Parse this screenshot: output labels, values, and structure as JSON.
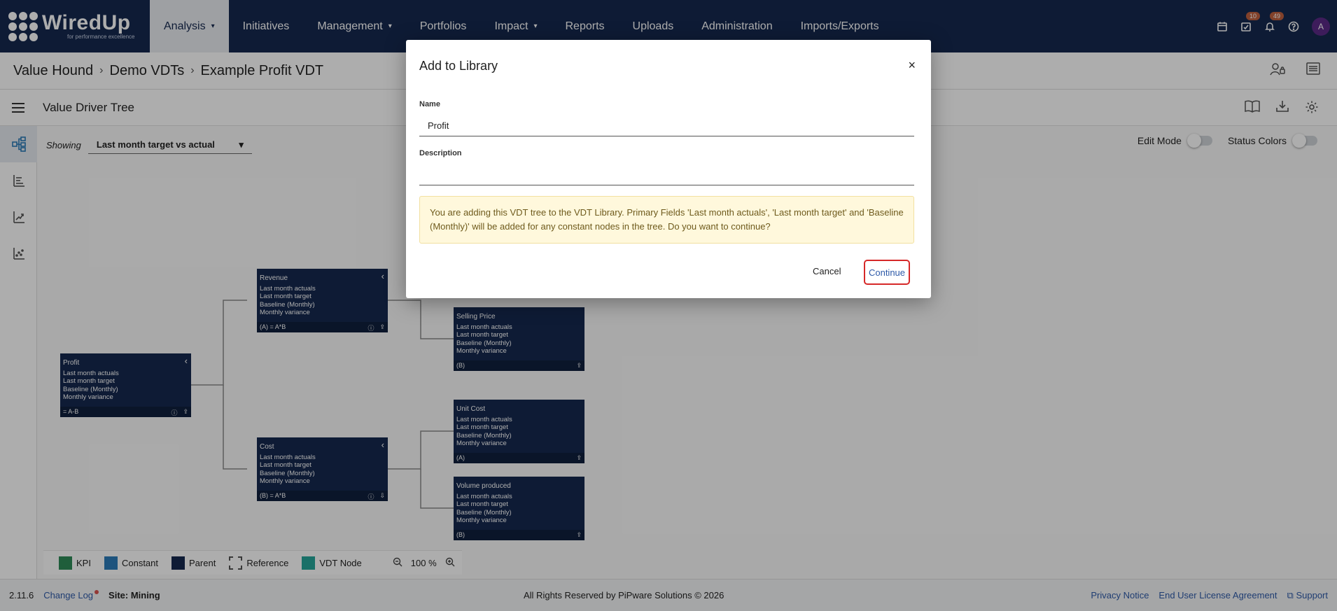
{
  "brand": {
    "word": "WiredUp",
    "tagline": "for performance excellence"
  },
  "nav": {
    "items": [
      {
        "label": "Analysis",
        "caret": "▾"
      },
      {
        "label": "Initiatives",
        "caret": ""
      },
      {
        "label": "Management",
        "caret": "▾"
      },
      {
        "label": "Portfolios",
        "caret": ""
      },
      {
        "label": "Impact",
        "caret": "▾"
      },
      {
        "label": "Reports",
        "caret": ""
      },
      {
        "label": "Uploads",
        "caret": ""
      },
      {
        "label": "Administration",
        "caret": ""
      },
      {
        "label": "Imports/Exports",
        "caret": ""
      }
    ],
    "tasks_badge": "10",
    "notifications_badge": "49",
    "avatar": "A"
  },
  "breadcrumb": [
    "Value Hound",
    "Demo VDTs",
    "Example Profit VDT"
  ],
  "toolbar": {
    "title": "Value Driver Tree"
  },
  "showing": {
    "label": "Showing",
    "value": "Last month target vs actual"
  },
  "toggles": {
    "edit_mode": "Edit Mode",
    "status_colors": "Status Colors"
  },
  "nodes": [
    {
      "title": "Profit",
      "fields": [
        "Last month actuals",
        "Last month target",
        "Baseline (Monthly)",
        "Monthly variance"
      ],
      "formula": "= A-B"
    },
    {
      "title": "Revenue",
      "fields": [
        "Last month actuals",
        "Last month target",
        "Baseline (Monthly)",
        "Monthly variance"
      ],
      "formula": "(A) = A*B"
    },
    {
      "title": "Selling Price",
      "fields": [
        "Last month actuals",
        "Last month target",
        "Baseline (Monthly)",
        "Monthly variance"
      ],
      "formula": "(B)"
    },
    {
      "title": "Unit Cost",
      "fields": [
        "Last month actuals",
        "Last month target",
        "Baseline (Monthly)",
        "Monthly variance"
      ],
      "formula": "(A)"
    },
    {
      "title": "Cost",
      "fields": [
        "Last month actuals",
        "Last month target",
        "Baseline (Monthly)",
        "Monthly variance"
      ],
      "formula": "(B) = A*B"
    },
    {
      "title": "Volume produced",
      "fields": [
        "Last month actuals",
        "Last month target",
        "Baseline (Monthly)",
        "Monthly variance"
      ],
      "formula": "(B)"
    }
  ],
  "legend": [
    {
      "label": "KPI",
      "color": "#2e8b57"
    },
    {
      "label": "Constant",
      "color": "#2b7bb9"
    },
    {
      "label": "Parent",
      "color": "#16294e"
    },
    {
      "label": "Reference",
      "color": "dashed"
    },
    {
      "label": "VDT Node",
      "color": "#26a69a"
    }
  ],
  "zoom": {
    "value": "100 %"
  },
  "footer": {
    "version": "2.11.6",
    "changelog": "Change Log",
    "site": "Site: Mining",
    "copyright": "All Rights Reserved by PiPware Solutions © 2026",
    "privacy": "Privacy Notice",
    "eula": "End User License Agreement",
    "support": "Support"
  },
  "modal": {
    "title": "Add to Library",
    "close": "×",
    "name_label": "Name",
    "name_value": "Profit",
    "description_label": "Description",
    "description_value": "",
    "warning": "You are adding this VDT tree to the VDT Library. Primary Fields 'Last month actuals', 'Last month target' and 'Baseline (Monthly)' will be added for any constant nodes in the tree. Do you want to continue?",
    "cancel": "Cancel",
    "continue": "Continue"
  }
}
